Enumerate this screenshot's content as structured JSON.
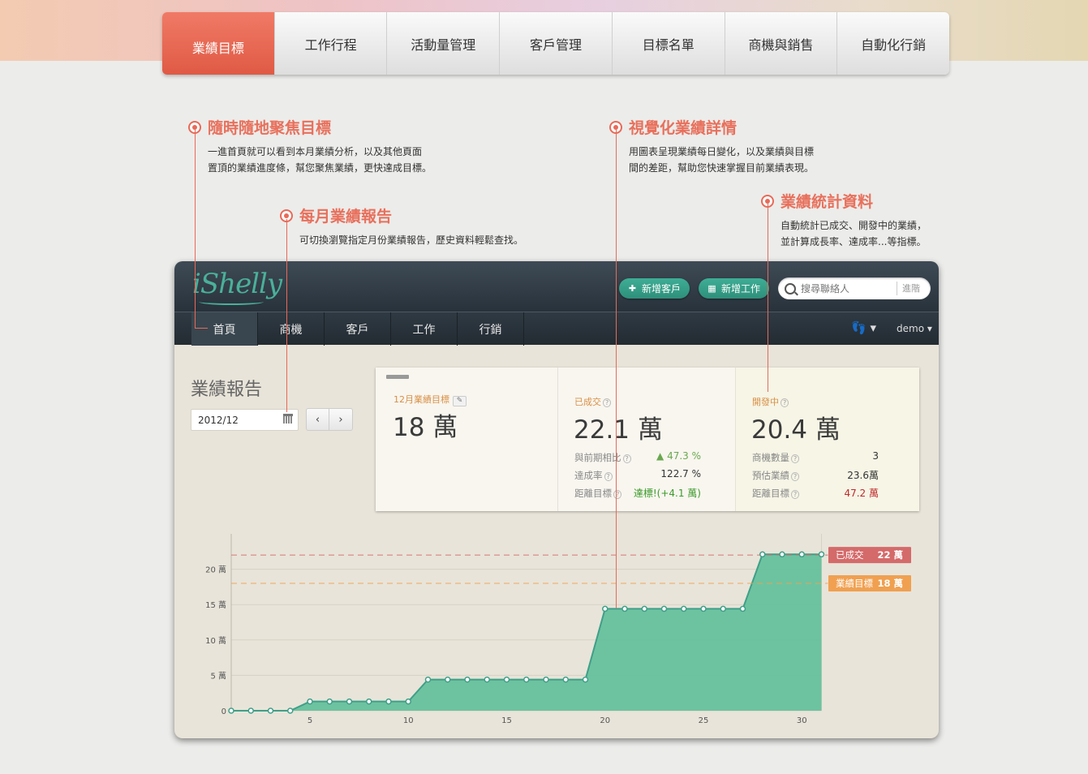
{
  "top_nav": {
    "tabs": [
      "業績目標",
      "工作行程",
      "活動量管理",
      "客戶管理",
      "目標名單",
      "商機與銷售",
      "自動化行銷"
    ]
  },
  "callouts": {
    "focus": {
      "title": "隨時隨地聚焦目標",
      "line1": "一進首頁就可以看到本月業績分析，以及其他頁面",
      "line2": "置頂的業績進度條，幫您聚焦業績，更快達成目標。"
    },
    "monthly": {
      "title": "每月業績報告",
      "line1": "可切換瀏覽指定月份業績報告，歷史資料輕鬆查找。"
    },
    "visual": {
      "title": "視覺化業績詳情",
      "line1": "用圖表呈現業績每日變化，以及業績與目標",
      "line2": "間的差距，幫助您快速掌握目前業績表現。"
    },
    "stats": {
      "title": "業績統計資料",
      "line1": "自動統計已成交、開發中的業績，",
      "line2": "並計算成長率、達成率...等指標。"
    }
  },
  "app": {
    "logo": "iShelly",
    "add_customer": "新增客戶",
    "add_task": "新增工作",
    "search_placeholder": "搜尋聯絡人",
    "advanced": "進階",
    "nav": [
      "首頁",
      "商機",
      "客戶",
      "工作",
      "行銷"
    ],
    "user": "demo",
    "report_title": "業績報告",
    "month": "2012/12",
    "prev": "‹",
    "next": "›"
  },
  "stats": {
    "target_label": "12月業績目標",
    "target_value": "18 萬",
    "closed_label": "已成交",
    "closed_value": "22.1 萬",
    "growth_label": "與前期相比",
    "growth_value": "47.3 %",
    "achieve_label": "達成率",
    "achieve_value": "122.7 %",
    "gap_label": "距離目標",
    "gap_value": "達標!(+4.1 萬)",
    "dev_label": "開發中",
    "dev_value": "20.4 萬",
    "count_label": "商機數量",
    "count_value": "3",
    "est_label": "預估業績",
    "est_value": "23.6萬",
    "dev_gap_label": "距離目標",
    "dev_gap_value": "47.2 萬"
  },
  "chart_data": {
    "type": "area",
    "x": [
      1,
      2,
      3,
      4,
      5,
      6,
      7,
      8,
      9,
      10,
      11,
      12,
      13,
      14,
      15,
      16,
      17,
      18,
      19,
      20,
      21,
      22,
      23,
      24,
      25,
      26,
      27,
      28,
      29,
      30,
      31
    ],
    "series": [
      {
        "values": [
          0,
          0,
          0,
          0,
          1.3,
          1.3,
          1.3,
          1.3,
          1.3,
          1.3,
          4.4,
          4.4,
          4.4,
          4.4,
          4.4,
          4.4,
          4.4,
          4.4,
          4.4,
          14.4,
          14.4,
          14.4,
          14.4,
          14.4,
          14.4,
          14.4,
          14.4,
          22.1,
          22.1,
          22.1,
          22.1
        ]
      }
    ],
    "x_ticks": [
      5,
      10,
      15,
      20,
      25,
      30
    ],
    "y_ticks": [
      0,
      5,
      10,
      15,
      20
    ],
    "y_tick_labels": [
      "0",
      "5 萬",
      "10 萬",
      "15 萬",
      "20 萬"
    ],
    "ylim": [
      0,
      25
    ],
    "reference_lines": [
      {
        "label": "已成交",
        "value_label": "22 萬",
        "value": 22,
        "color": "#d46a6a"
      },
      {
        "label": "業績目標",
        "value_label": "18 萬",
        "value": 18,
        "color": "#f0a050"
      }
    ],
    "fill_color": "#5fbf99",
    "line_color": "#3f9f88"
  }
}
